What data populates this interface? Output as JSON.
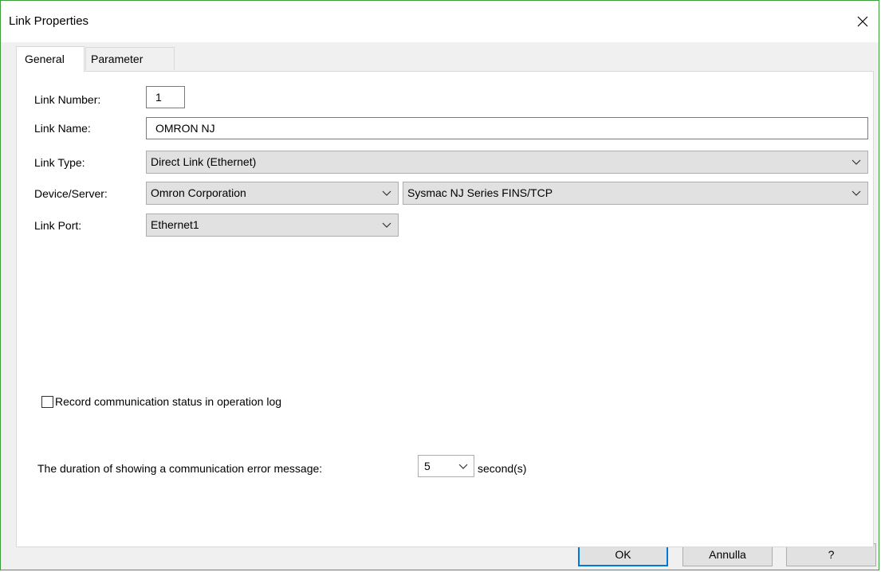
{
  "window": {
    "title": "Link Properties"
  },
  "tabs": [
    {
      "label": "General",
      "active": true
    },
    {
      "label": "Parameter",
      "active": false
    }
  ],
  "general": {
    "link_number": {
      "label": "Link Number:",
      "value": "1"
    },
    "link_name": {
      "label": "Link Name:",
      "value": "OMRON NJ"
    },
    "link_type": {
      "label": "Link Type:",
      "value": "Direct Link (Ethernet)"
    },
    "device_server": {
      "label": "Device/Server:",
      "manufacturer": "Omron Corporation",
      "model": "Sysmac NJ Series FINS/TCP"
    },
    "link_port": {
      "label": "Link Port:",
      "value": "Ethernet1"
    },
    "record_log": {
      "label": "Record communication status in operation log",
      "checked": false
    },
    "error_duration": {
      "label": "The duration of showing a communication error message:",
      "value": "5",
      "unit": "second(s)"
    }
  },
  "buttons": {
    "ok": "OK",
    "cancel": "Annulla",
    "help": "?"
  },
  "icons": {
    "close": "close-icon",
    "dropdown": "chevron-down-icon"
  },
  "colors": {
    "window_border": "#3c9d3c",
    "default_button_border": "#0078d7"
  }
}
